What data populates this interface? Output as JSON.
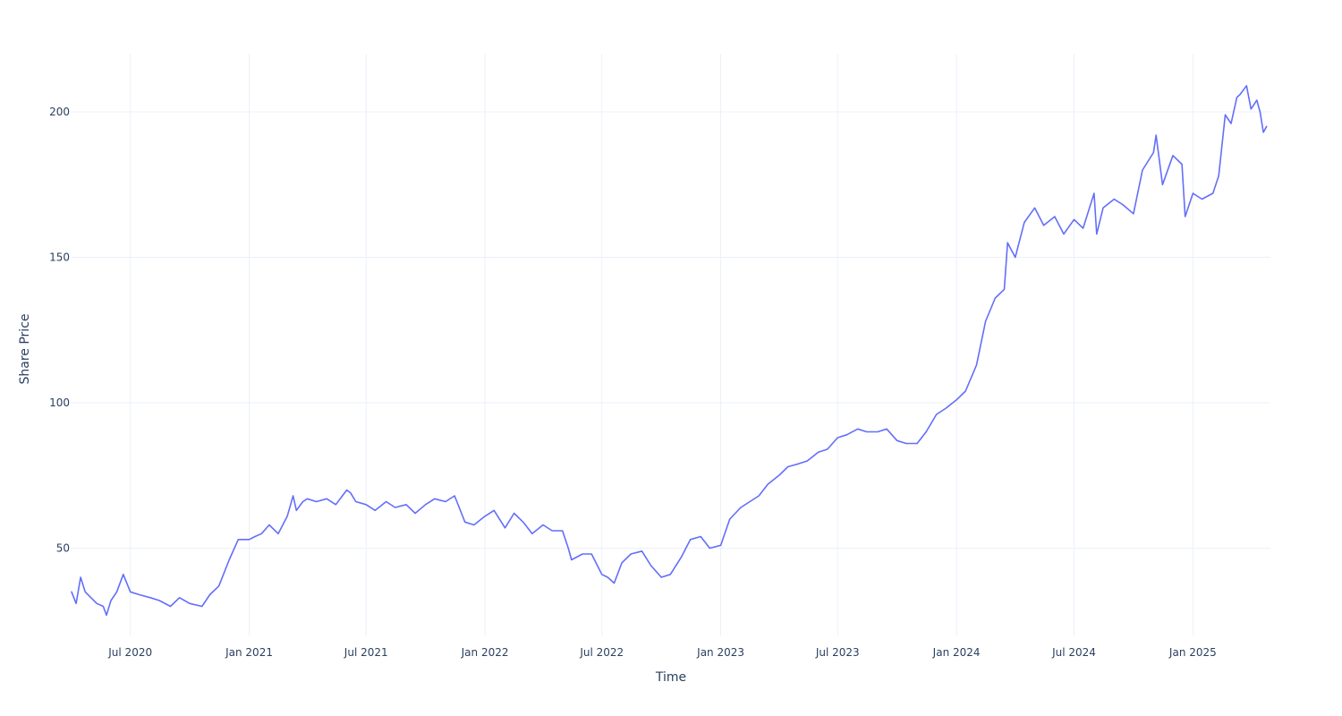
{
  "chart_data": {
    "type": "line",
    "title": "",
    "xlabel": "Time",
    "ylabel": "Share Price",
    "grid": true,
    "legend": "none",
    "x_range": [
      "2020-04-01",
      "2025-05-01"
    ],
    "ylim": [
      20,
      220
    ],
    "x_ticks": [
      {
        "date": "2020-07-01",
        "label": "Jul 2020"
      },
      {
        "date": "2021-01-01",
        "label": "Jan 2021"
      },
      {
        "date": "2021-07-01",
        "label": "Jul 2021"
      },
      {
        "date": "2022-01-01",
        "label": "Jan 2022"
      },
      {
        "date": "2022-07-01",
        "label": "Jul 2022"
      },
      {
        "date": "2023-01-01",
        "label": "Jan 2023"
      },
      {
        "date": "2023-07-01",
        "label": "Jul 2023"
      },
      {
        "date": "2024-01-01",
        "label": "Jan 2024"
      },
      {
        "date": "2024-07-01",
        "label": "Jul 2024"
      },
      {
        "date": "2025-01-01",
        "label": "Jan 2025"
      }
    ],
    "y_ticks": [
      50,
      100,
      150,
      200
    ],
    "series": [
      {
        "color": "#636efa",
        "x": [
          "2020-04-01",
          "2020-04-08",
          "2020-04-15",
          "2020-04-22",
          "2020-05-01",
          "2020-05-10",
          "2020-05-20",
          "2020-05-25",
          "2020-06-01",
          "2020-06-10",
          "2020-06-20",
          "2020-07-01",
          "2020-07-15",
          "2020-08-01",
          "2020-08-15",
          "2020-09-01",
          "2020-09-15",
          "2020-10-01",
          "2020-10-20",
          "2020-11-01",
          "2020-11-15",
          "2020-12-01",
          "2020-12-15",
          "2021-01-01",
          "2021-01-10",
          "2021-01-20",
          "2021-02-01",
          "2021-02-15",
          "2021-03-01",
          "2021-03-10",
          "2021-03-15",
          "2021-03-25",
          "2021-04-01",
          "2021-04-15",
          "2021-05-01",
          "2021-05-15",
          "2021-06-01",
          "2021-06-07",
          "2021-06-15",
          "2021-07-01",
          "2021-07-15",
          "2021-08-01",
          "2021-08-15",
          "2021-09-01",
          "2021-09-15",
          "2021-10-01",
          "2021-10-15",
          "2021-11-01",
          "2021-11-15",
          "2021-12-01",
          "2021-12-15",
          "2022-01-01",
          "2022-01-15",
          "2022-02-01",
          "2022-02-15",
          "2022-03-01",
          "2022-03-15",
          "2022-04-01",
          "2022-04-15",
          "2022-05-01",
          "2022-05-10",
          "2022-05-15",
          "2022-06-01",
          "2022-06-15",
          "2022-07-01",
          "2022-07-10",
          "2022-07-20",
          "2022-08-01",
          "2022-08-15",
          "2022-09-01",
          "2022-09-15",
          "2022-10-01",
          "2022-10-15",
          "2022-11-01",
          "2022-11-15",
          "2022-12-01",
          "2022-12-15",
          "2023-01-01",
          "2023-01-15",
          "2023-02-01",
          "2023-02-15",
          "2023-03-01",
          "2023-03-15",
          "2023-04-01",
          "2023-04-15",
          "2023-05-01",
          "2023-05-15",
          "2023-06-01",
          "2023-06-15",
          "2023-07-01",
          "2023-07-15",
          "2023-08-01",
          "2023-08-15",
          "2023-09-01",
          "2023-09-15",
          "2023-10-01",
          "2023-10-15",
          "2023-11-01",
          "2023-11-15",
          "2023-12-01",
          "2023-12-15",
          "2024-01-01",
          "2024-01-15",
          "2024-02-01",
          "2024-02-15",
          "2024-03-01",
          "2024-03-15",
          "2024-03-20",
          "2024-04-01",
          "2024-04-15",
          "2024-05-01",
          "2024-05-15",
          "2024-06-01",
          "2024-06-15",
          "2024-07-01",
          "2024-07-15",
          "2024-08-01",
          "2024-08-05",
          "2024-08-15",
          "2024-09-01",
          "2024-09-15",
          "2024-10-01",
          "2024-10-15",
          "2024-11-01",
          "2024-11-05",
          "2024-11-15",
          "2024-12-01",
          "2024-12-15",
          "2024-12-20",
          "2025-01-01",
          "2025-01-15",
          "2025-02-01",
          "2025-02-10",
          "2025-02-20",
          "2025-03-01",
          "2025-03-10",
          "2025-03-15",
          "2025-03-25",
          "2025-04-01",
          "2025-04-10",
          "2025-04-15",
          "2025-04-20",
          "2025-04-25"
        ],
        "y": [
          35,
          31,
          40,
          35,
          33,
          31,
          30,
          27,
          32,
          35,
          41,
          35,
          34,
          33,
          32,
          30,
          33,
          31,
          30,
          34,
          37,
          46,
          53,
          53,
          54,
          55,
          58,
          55,
          61,
          68,
          63,
          66,
          67,
          66,
          67,
          65,
          70,
          69,
          66,
          65,
          63,
          66,
          64,
          65,
          62,
          65,
          67,
          66,
          68,
          59,
          58,
          61,
          63,
          57,
          62,
          59,
          55,
          58,
          56,
          56,
          50,
          46,
          48,
          48,
          41,
          40,
          38,
          45,
          48,
          49,
          44,
          40,
          41,
          47,
          53,
          54,
          50,
          51,
          60,
          64,
          66,
          68,
          72,
          75,
          78,
          79,
          80,
          83,
          84,
          88,
          89,
          91,
          90,
          90,
          91,
          87,
          86,
          86,
          90,
          96,
          98,
          101,
          104,
          113,
          128,
          136,
          139,
          155,
          150,
          162,
          167,
          161,
          164,
          158,
          163,
          160,
          172,
          158,
          167,
          170,
          168,
          165,
          180,
          186,
          192,
          175,
          185,
          182,
          164,
          172,
          170,
          172,
          178,
          199,
          196,
          205,
          206,
          209,
          201,
          204,
          200,
          193,
          195
        ]
      }
    ]
  }
}
